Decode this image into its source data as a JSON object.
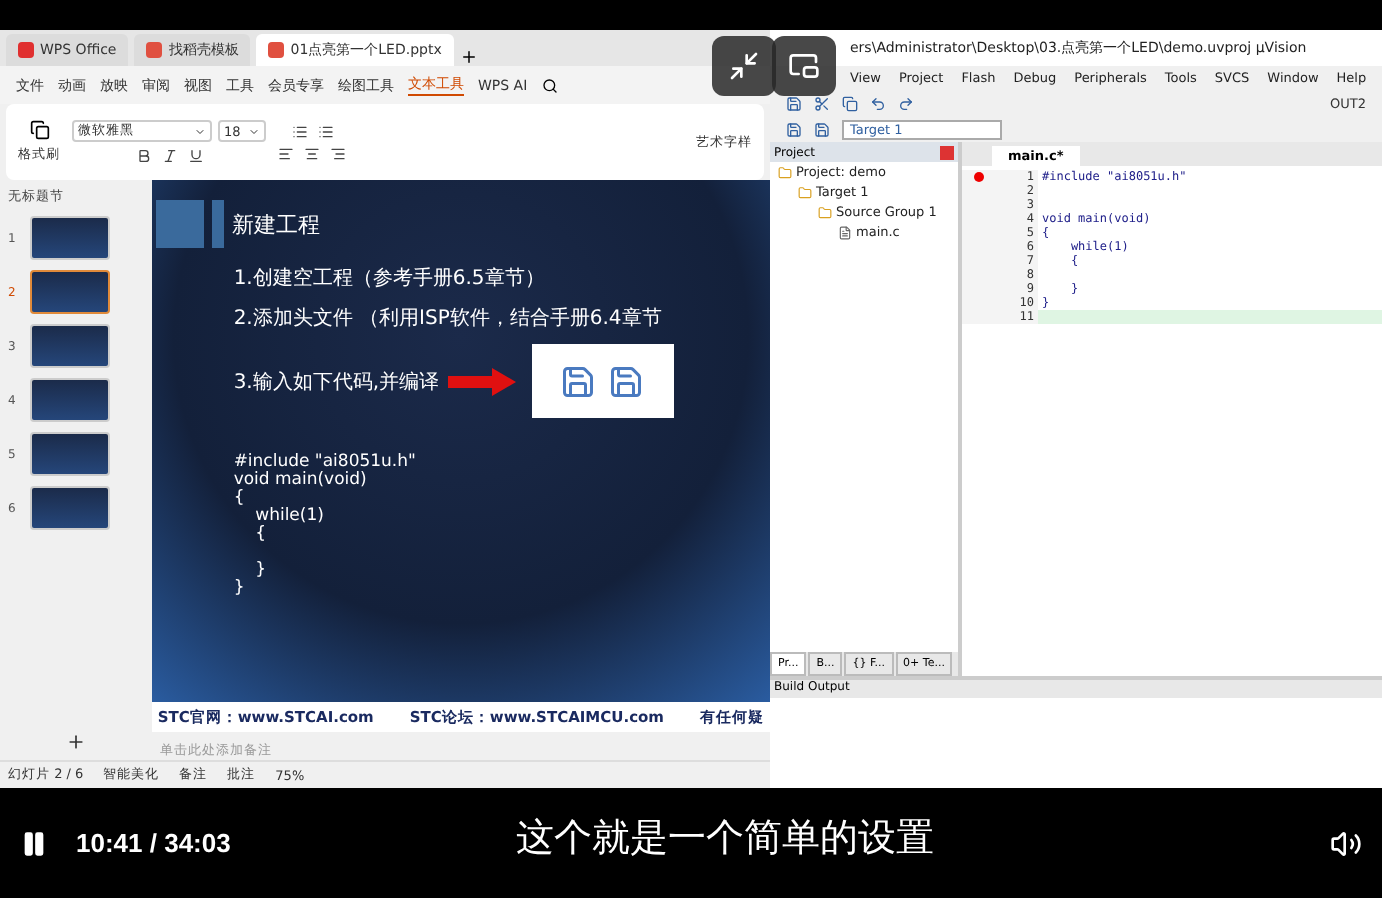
{
  "wps": {
    "tabs": [
      {
        "label": "WPS Office",
        "selected": false
      },
      {
        "label": "找稻壳模板",
        "selected": false
      },
      {
        "label": "01点亮第一个LED.pptx",
        "selected": true
      }
    ],
    "menu": [
      {
        "label": "文件",
        "selected": false
      },
      {
        "label": "动画",
        "selected": false
      },
      {
        "label": "放映",
        "selected": false
      },
      {
        "label": "审阅",
        "selected": false
      },
      {
        "label": "视图",
        "selected": false
      },
      {
        "label": "工具",
        "selected": false
      },
      {
        "label": "会员专享",
        "selected": false
      },
      {
        "label": "绘图工具",
        "selected": false
      },
      {
        "label": "文本工具",
        "selected": true
      },
      {
        "label": "WPS AI",
        "selected": false
      }
    ],
    "ribbon": {
      "format_painter": "格式刷",
      "font_name": "微软雅黑",
      "font_size": "18",
      "art_text": "艺术字样"
    },
    "section": "无标题节",
    "slides": [
      {
        "number": "1",
        "selected": false
      },
      {
        "number": "2",
        "selected": true
      },
      {
        "number": "3",
        "selected": false
      },
      {
        "number": "4",
        "selected": false
      },
      {
        "number": "5",
        "selected": false
      },
      {
        "number": "6",
        "selected": false
      }
    ],
    "slide": {
      "title": "新建工程",
      "steps": [
        "1.创建空工程（参考手册6.5章节）",
        "2.添加头文件 （利用ISP软件，结合手册6.4章节",
        "3.输入如下代码,并编译"
      ],
      "code": [
        {
          "kind": "text",
          "text": "#include \"ai8051u.h\""
        },
        {
          "kind": "text",
          "text": "void main(void)"
        },
        {
          "kind": "text",
          "text": "{"
        },
        {
          "kind": "text",
          "text": "    while(1)"
        },
        {
          "kind": "text",
          "text": "    {"
        },
        {
          "kind": "blank"
        },
        {
          "kind": "text",
          "text": "    }"
        },
        {
          "kind": "text",
          "text": "}"
        }
      ],
      "footer": [
        "STC官网：www.STCAI.com",
        "STC论坛：www.STCAIMCU.com",
        "有任何疑"
      ]
    },
    "notes_placeholder": "单击此处添加备注",
    "status": {
      "slide_count": "幻灯片 2 / 6",
      "beautify": "智能美化",
      "notes": "备注",
      "comments": "批注",
      "zoom": "75%"
    }
  },
  "keil": {
    "title": "ers\\Administrator\\Desktop\\03.点亮第一个LED\\demo.uvproj  µVision",
    "menu": [
      "View",
      "Project",
      "Flash",
      "Debug",
      "Peripherals",
      "Tools",
      "SVCS",
      "Window",
      "Help"
    ],
    "toolbar_output": "OUT2",
    "target": "Target 1",
    "project_title": "Project",
    "tree": [
      {
        "label": "Project: demo",
        "children": [
          {
            "label": "Target 1",
            "children": [
              {
                "label": "Source Group 1",
                "children": [
                  {
                    "label": "main.c"
                  }
                ]
              }
            ]
          }
        ]
      }
    ],
    "panel_tabs": [
      {
        "label": "Pr...",
        "selected": true
      },
      {
        "label": "B...",
        "selected": false
      },
      {
        "label": "{} F...",
        "selected": false
      },
      {
        "label": "0+ Te...",
        "selected": false
      }
    ],
    "editor_tab": "main.c*",
    "lines": [
      {
        "number": "1",
        "text": "#include \"ai8051u.h\"",
        "breakpoint": true,
        "current": false
      },
      {
        "number": "2",
        "breakpoint": false,
        "current": false
      },
      {
        "number": "3",
        "breakpoint": false,
        "current": false
      },
      {
        "number": "4",
        "text": "void main(void)",
        "breakpoint": false,
        "current": false
      },
      {
        "number": "5",
        "text": "{",
        "breakpoint": false,
        "current": false
      },
      {
        "number": "6",
        "text": "    while(1)",
        "breakpoint": false,
        "current": false
      },
      {
        "number": "7",
        "text": "    {",
        "breakpoint": false,
        "current": false
      },
      {
        "number": "8",
        "breakpoint": false,
        "current": false
      },
      {
        "number": "9",
        "text": "    }",
        "breakpoint": false,
        "current": false
      },
      {
        "number": "10",
        "text": "}",
        "breakpoint": false,
        "current": false
      },
      {
        "number": "11",
        "breakpoint": false,
        "current": true
      }
    ],
    "build_output": "Build Output"
  },
  "player": {
    "playing": true,
    "time": "10:41 / 34:03",
    "subtitle": "这个就是一个简单的设置"
  }
}
